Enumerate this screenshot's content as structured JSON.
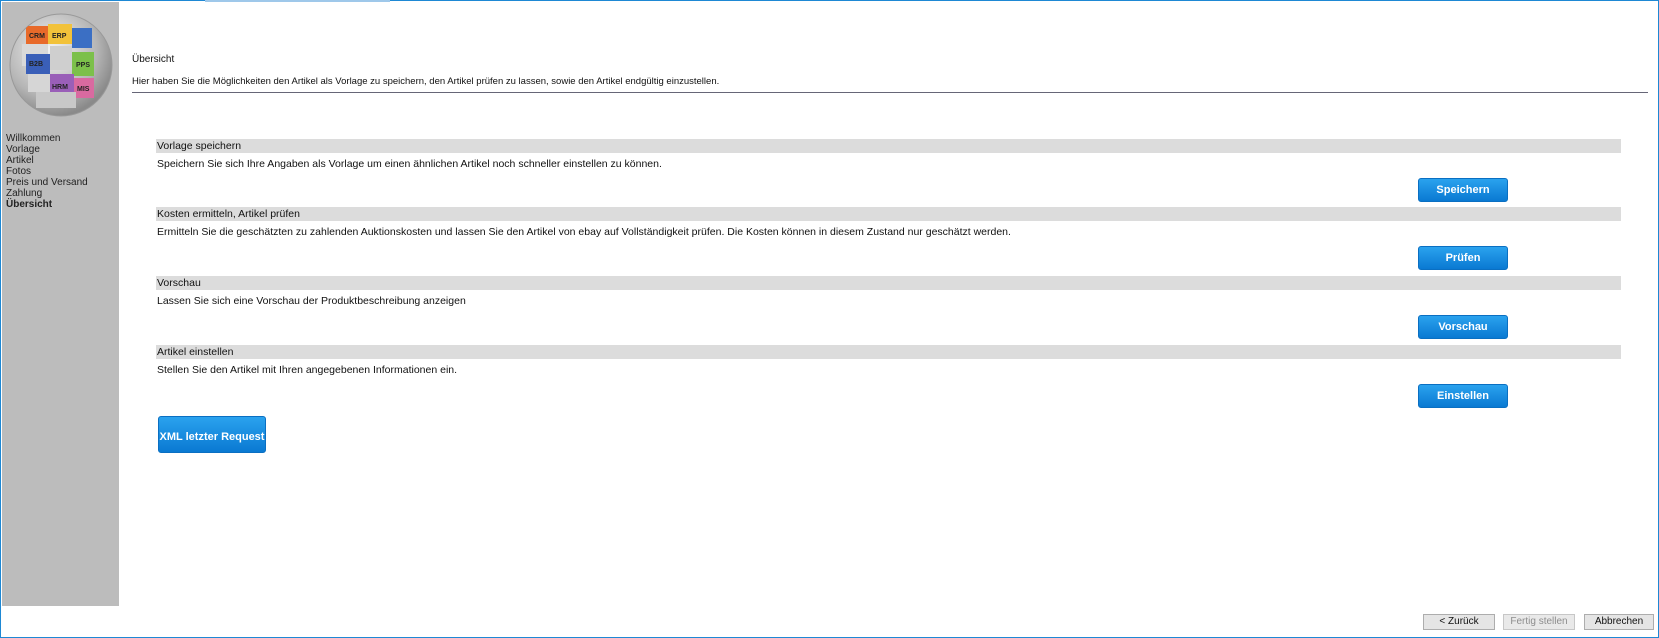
{
  "sidebar": {
    "logo_labels": [
      "CRM",
      "ERP",
      "B2B",
      "PPS",
      "HRM",
      "MIS"
    ],
    "nav": [
      {
        "label": "Willkommen",
        "active": false
      },
      {
        "label": "Vorlage",
        "active": false
      },
      {
        "label": "Artikel",
        "active": false
      },
      {
        "label": "Fotos",
        "active": false
      },
      {
        "label": "Preis und Versand",
        "active": false
      },
      {
        "label": "Zahlung",
        "active": false
      },
      {
        "label": "Übersicht",
        "active": true
      }
    ]
  },
  "header": {
    "title": "Übersicht",
    "description": "Hier haben Sie die Möglichkeiten den Artikel als Vorlage zu speichern, den Artikel prüfen zu lassen, sowie den Artikel endgültig einzustellen."
  },
  "sections": [
    {
      "header": "Vorlage speichern",
      "text": "Speichern Sie sich Ihre Angaben als Vorlage um einen ähnlichen Artikel noch schneller einstellen zu können.",
      "button": "Speichern"
    },
    {
      "header": "Kosten ermitteln, Artikel prüfen",
      "text": "Ermitteln Sie die geschätzten zu zahlenden Auktionskosten und lassen Sie den Artikel von ebay auf Vollständigkeit prüfen. Die Kosten können in diesem Zustand nur geschätzt werden.",
      "button": "Prüfen"
    },
    {
      "header": "Vorschau",
      "text": "Lassen Sie sich eine Vorschau der Produktbeschreibung anzeigen",
      "button": "Vorschau"
    },
    {
      "header": "Artikel einstellen",
      "text": "Stellen Sie den Artikel mit Ihren angegebenen Informationen ein.",
      "button": "Einstellen"
    }
  ],
  "xml_button": "XML letzter Request",
  "wizard": {
    "back": "< Zurück",
    "finish": "Fertig stellen",
    "cancel": "Abbrechen"
  },
  "colors": {
    "accent": "#0a79d2",
    "sidebar_bg": "#bcbcbc",
    "section_header_bg": "#dcdcdc",
    "frame_border": "#1e88d4"
  }
}
